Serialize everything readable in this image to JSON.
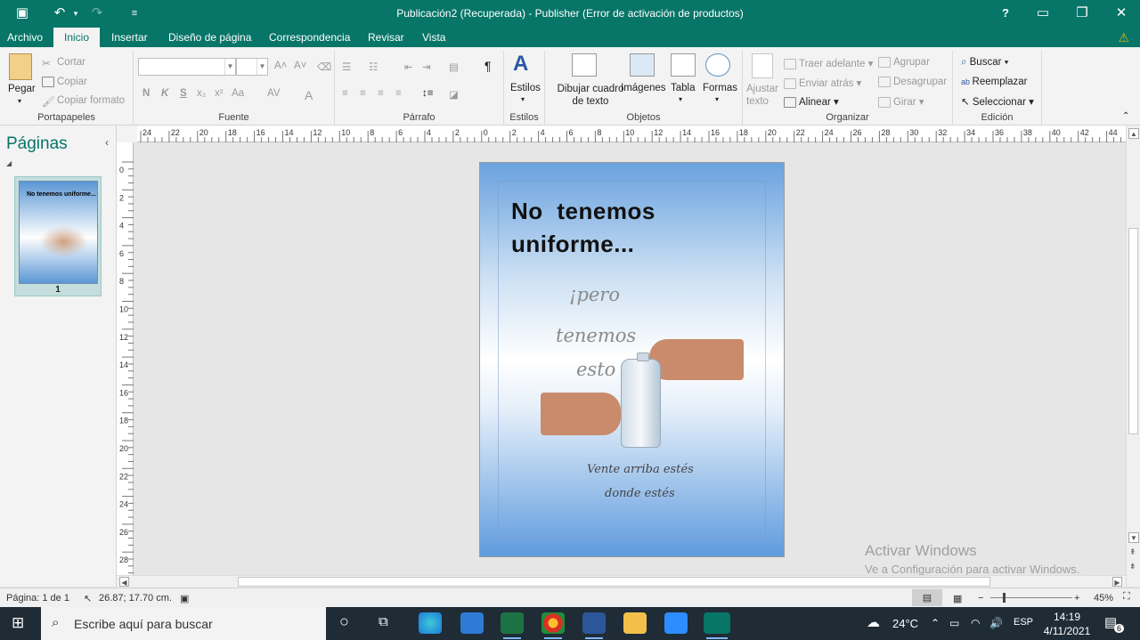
{
  "window": {
    "title": "Publicación2 (Recuperada) - Publisher (Error de activación de productos)",
    "help": "?"
  },
  "tabs": [
    "Archivo",
    "Inicio",
    "Insertar",
    "Diseño de página",
    "Correspondencia",
    "Revisar",
    "Vista"
  ],
  "ribbon": {
    "portapapeles": {
      "pegar": "Pegar",
      "cortar": "Cortar",
      "copiar": "Copiar",
      "copiar_formato": "Copiar formato",
      "label": "Portapapeles"
    },
    "fuente": {
      "label": "Fuente",
      "letters": [
        "N",
        "K",
        "S",
        "x₂",
        "x²",
        "Aa"
      ]
    },
    "parrafo": {
      "label": "Párrafo",
      "pilcrow": "¶"
    },
    "estilos": {
      "btn": "Estilos",
      "label": "Estilos"
    },
    "objetos": {
      "dibujar": "Dibujar cuadro de texto",
      "imagenes": "Imágenes",
      "tabla": "Tabla",
      "formas": "Formas",
      "label": "Objetos"
    },
    "organizar": {
      "ajustar": "Ajustar texto",
      "traer": "Traer adelante",
      "enviar": "Enviar atrás",
      "alinear": "Alinear",
      "agrupar": "Agrupar",
      "desagrupar": "Desagrupar",
      "girar": "Girar",
      "label": "Organizar"
    },
    "edicion": {
      "buscar": "Buscar",
      "reemplazar": "Reemplazar",
      "seleccionar": "Seleccionar",
      "label": "Edición"
    }
  },
  "pages_panel": {
    "title": "Páginas",
    "page_number": "1",
    "thumb_text": "No tenemos uniforme..."
  },
  "hruler_labels": [
    "24",
    "22",
    "20",
    "18",
    "16",
    "14",
    "12",
    "10",
    "8",
    "6",
    "4",
    "2",
    "0",
    "2",
    "4",
    "6",
    "8",
    "10",
    "12",
    "14",
    "16",
    "18",
    "20",
    "22",
    "24",
    "26",
    "28",
    "30",
    "32",
    "34",
    "36",
    "38",
    "40",
    "42",
    "44"
  ],
  "vruler_labels": [
    "0",
    "2",
    "4",
    "6",
    "8",
    "10",
    "12",
    "14",
    "16",
    "18",
    "20",
    "22",
    "24",
    "26",
    "28"
  ],
  "document": {
    "headline_1": "No tenemos",
    "headline_2": "uniforme...",
    "pero": "¡pero",
    "tenemos": "tenemos",
    "esto": "esto",
    "line1": "Vente arriba estés",
    "line2": "donde estés"
  },
  "watermark": {
    "line1": "Activar Windows",
    "line2": "Ve a Configuración para activar Windows."
  },
  "status": {
    "page": "Página: 1 de 1",
    "coords": "26.87; 17.70 cm.",
    "zoom": "45%"
  },
  "taskbar": {
    "search_placeholder": "Escribe aquí para buscar",
    "weather": "24°C",
    "lang": "ESP",
    "time": "14:19",
    "date": "4/11/2021",
    "notif_count": "6"
  },
  "colors": {
    "accent": "#077568",
    "taskbar": "#1f2c36"
  }
}
